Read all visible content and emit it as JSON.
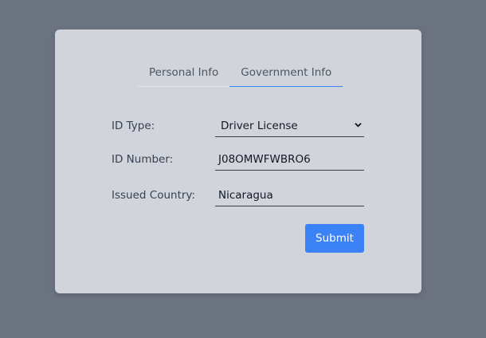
{
  "tabs": [
    {
      "label": "Personal Info",
      "active": false
    },
    {
      "label": "Government Info",
      "active": true
    }
  ],
  "form": {
    "id_type": {
      "label": "ID Type:",
      "value": "Driver License"
    },
    "id_number": {
      "label": "ID Number:",
      "value": "J08OMWFWBRO6"
    },
    "issued_country": {
      "label": "Issued Country:",
      "value": "Nicaragua"
    }
  },
  "submit_label": "Submit",
  "colors": {
    "background": "#6b7280",
    "card": "#d1d5db",
    "accent": "#3b82f6"
  },
  "icons": {
    "select_arrow": "chevron-down-icon"
  }
}
